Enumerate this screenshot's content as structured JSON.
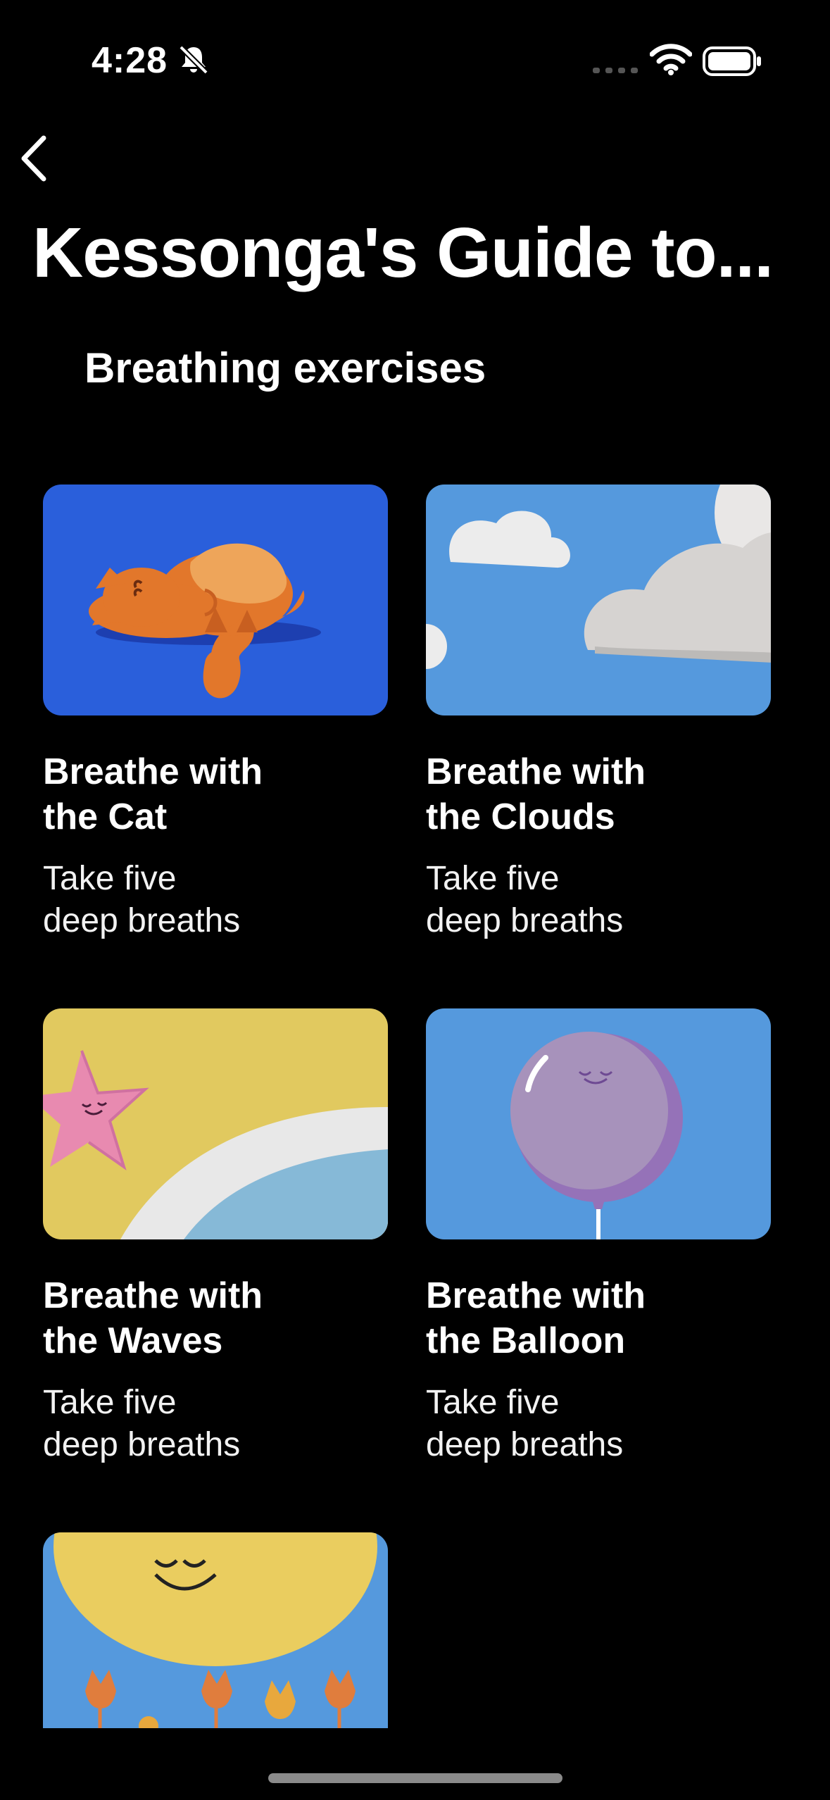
{
  "status_bar": {
    "time": "4:28"
  },
  "header": {
    "title": "Kessonga's Guide to..."
  },
  "section": {
    "title": "Breathing exercises"
  },
  "cards": [
    {
      "title": "Breathe with\nthe Cat",
      "subtitle": "Take five\ndeep breaths"
    },
    {
      "title": "Breathe with\nthe Clouds",
      "subtitle": "Take five\ndeep breaths"
    },
    {
      "title": "Breathe with\nthe Waves",
      "subtitle": "Take five\ndeep breaths"
    },
    {
      "title": "Breathe with\nthe Balloon",
      "subtitle": "Take five\ndeep breaths"
    }
  ],
  "colors": {
    "background": "#000000",
    "text": "#ffffff",
    "cat_bg": "#2a5fdb",
    "sky_bg": "#5599dd",
    "waves_bg": "#e1c95f"
  }
}
